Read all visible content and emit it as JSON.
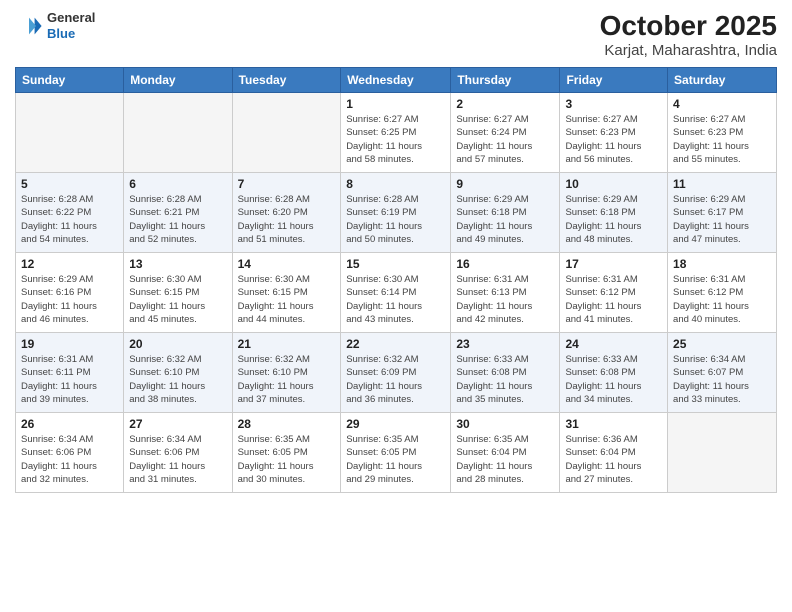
{
  "header": {
    "logo_line1": "General",
    "logo_line2": "Blue",
    "title": "October 2025",
    "subtitle": "Karjat, Maharashtra, India"
  },
  "days_of_week": [
    "Sunday",
    "Monday",
    "Tuesday",
    "Wednesday",
    "Thursday",
    "Friday",
    "Saturday"
  ],
  "weeks": [
    [
      {
        "day": "",
        "info": ""
      },
      {
        "day": "",
        "info": ""
      },
      {
        "day": "",
        "info": ""
      },
      {
        "day": "1",
        "info": "Sunrise: 6:27 AM\nSunset: 6:25 PM\nDaylight: 11 hours\nand 58 minutes."
      },
      {
        "day": "2",
        "info": "Sunrise: 6:27 AM\nSunset: 6:24 PM\nDaylight: 11 hours\nand 57 minutes."
      },
      {
        "day": "3",
        "info": "Sunrise: 6:27 AM\nSunset: 6:23 PM\nDaylight: 11 hours\nand 56 minutes."
      },
      {
        "day": "4",
        "info": "Sunrise: 6:27 AM\nSunset: 6:23 PM\nDaylight: 11 hours\nand 55 minutes."
      }
    ],
    [
      {
        "day": "5",
        "info": "Sunrise: 6:28 AM\nSunset: 6:22 PM\nDaylight: 11 hours\nand 54 minutes."
      },
      {
        "day": "6",
        "info": "Sunrise: 6:28 AM\nSunset: 6:21 PM\nDaylight: 11 hours\nand 52 minutes."
      },
      {
        "day": "7",
        "info": "Sunrise: 6:28 AM\nSunset: 6:20 PM\nDaylight: 11 hours\nand 51 minutes."
      },
      {
        "day": "8",
        "info": "Sunrise: 6:28 AM\nSunset: 6:19 PM\nDaylight: 11 hours\nand 50 minutes."
      },
      {
        "day": "9",
        "info": "Sunrise: 6:29 AM\nSunset: 6:18 PM\nDaylight: 11 hours\nand 49 minutes."
      },
      {
        "day": "10",
        "info": "Sunrise: 6:29 AM\nSunset: 6:18 PM\nDaylight: 11 hours\nand 48 minutes."
      },
      {
        "day": "11",
        "info": "Sunrise: 6:29 AM\nSunset: 6:17 PM\nDaylight: 11 hours\nand 47 minutes."
      }
    ],
    [
      {
        "day": "12",
        "info": "Sunrise: 6:29 AM\nSunset: 6:16 PM\nDaylight: 11 hours\nand 46 minutes."
      },
      {
        "day": "13",
        "info": "Sunrise: 6:30 AM\nSunset: 6:15 PM\nDaylight: 11 hours\nand 45 minutes."
      },
      {
        "day": "14",
        "info": "Sunrise: 6:30 AM\nSunset: 6:15 PM\nDaylight: 11 hours\nand 44 minutes."
      },
      {
        "day": "15",
        "info": "Sunrise: 6:30 AM\nSunset: 6:14 PM\nDaylight: 11 hours\nand 43 minutes."
      },
      {
        "day": "16",
        "info": "Sunrise: 6:31 AM\nSunset: 6:13 PM\nDaylight: 11 hours\nand 42 minutes."
      },
      {
        "day": "17",
        "info": "Sunrise: 6:31 AM\nSunset: 6:12 PM\nDaylight: 11 hours\nand 41 minutes."
      },
      {
        "day": "18",
        "info": "Sunrise: 6:31 AM\nSunset: 6:12 PM\nDaylight: 11 hours\nand 40 minutes."
      }
    ],
    [
      {
        "day": "19",
        "info": "Sunrise: 6:31 AM\nSunset: 6:11 PM\nDaylight: 11 hours\nand 39 minutes."
      },
      {
        "day": "20",
        "info": "Sunrise: 6:32 AM\nSunset: 6:10 PM\nDaylight: 11 hours\nand 38 minutes."
      },
      {
        "day": "21",
        "info": "Sunrise: 6:32 AM\nSunset: 6:10 PM\nDaylight: 11 hours\nand 37 minutes."
      },
      {
        "day": "22",
        "info": "Sunrise: 6:32 AM\nSunset: 6:09 PM\nDaylight: 11 hours\nand 36 minutes."
      },
      {
        "day": "23",
        "info": "Sunrise: 6:33 AM\nSunset: 6:08 PM\nDaylight: 11 hours\nand 35 minutes."
      },
      {
        "day": "24",
        "info": "Sunrise: 6:33 AM\nSunset: 6:08 PM\nDaylight: 11 hours\nand 34 minutes."
      },
      {
        "day": "25",
        "info": "Sunrise: 6:34 AM\nSunset: 6:07 PM\nDaylight: 11 hours\nand 33 minutes."
      }
    ],
    [
      {
        "day": "26",
        "info": "Sunrise: 6:34 AM\nSunset: 6:06 PM\nDaylight: 11 hours\nand 32 minutes."
      },
      {
        "day": "27",
        "info": "Sunrise: 6:34 AM\nSunset: 6:06 PM\nDaylight: 11 hours\nand 31 minutes."
      },
      {
        "day": "28",
        "info": "Sunrise: 6:35 AM\nSunset: 6:05 PM\nDaylight: 11 hours\nand 30 minutes."
      },
      {
        "day": "29",
        "info": "Sunrise: 6:35 AM\nSunset: 6:05 PM\nDaylight: 11 hours\nand 29 minutes."
      },
      {
        "day": "30",
        "info": "Sunrise: 6:35 AM\nSunset: 6:04 PM\nDaylight: 11 hours\nand 28 minutes."
      },
      {
        "day": "31",
        "info": "Sunrise: 6:36 AM\nSunset: 6:04 PM\nDaylight: 11 hours\nand 27 minutes."
      },
      {
        "day": "",
        "info": ""
      }
    ]
  ]
}
